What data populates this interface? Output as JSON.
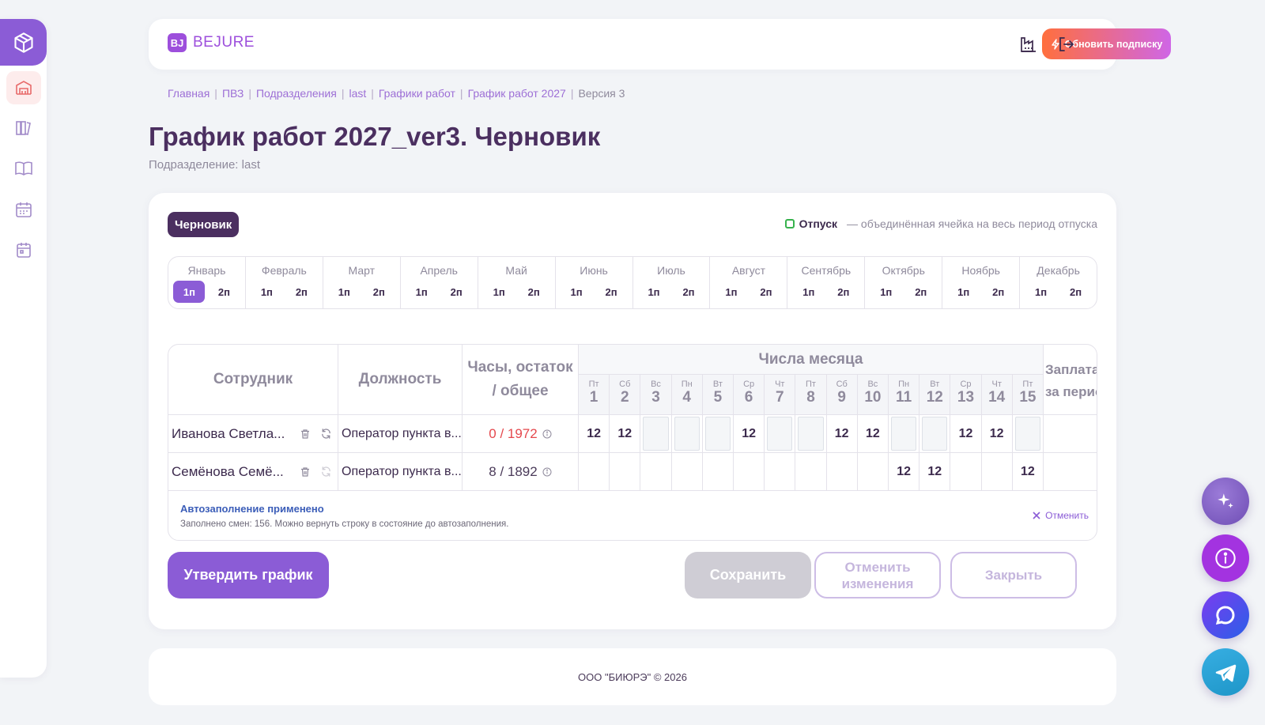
{
  "header": {
    "brand_mark": "BJ",
    "brand_name": "BEJURE",
    "upgrade_label": "Обновить подписку"
  },
  "breadcrumb": [
    "Главная",
    "ПВЗ",
    "Подразделения",
    "last",
    "Графики работ",
    "График работ 2027",
    "Версия 3"
  ],
  "page": {
    "title": "График работ 2027_ver3. Черновик",
    "subtitle": "Подразделение: last"
  },
  "card": {
    "status_badge": "Черновик",
    "legend_title": "Отпуск",
    "legend_text": "— объединённая ячейка на весь период отпуска"
  },
  "months": [
    {
      "name": "Январь",
      "p1": "1п",
      "p2": "2п"
    },
    {
      "name": "Февраль",
      "p1": "1п",
      "p2": "2п"
    },
    {
      "name": "Март",
      "p1": "1п",
      "p2": "2п"
    },
    {
      "name": "Апрель",
      "p1": "1п",
      "p2": "2п"
    },
    {
      "name": "Май",
      "p1": "1п",
      "p2": "2п"
    },
    {
      "name": "Июнь",
      "p1": "1п",
      "p2": "2п"
    },
    {
      "name": "Июль",
      "p1": "1п",
      "p2": "2п"
    },
    {
      "name": "Август",
      "p1": "1п",
      "p2": "2п"
    },
    {
      "name": "Сентябрь",
      "p1": "1п",
      "p2": "2п"
    },
    {
      "name": "Октябрь",
      "p1": "1п",
      "p2": "2п"
    },
    {
      "name": "Ноябрь",
      "p1": "1п",
      "p2": "2п"
    },
    {
      "name": "Декабрь",
      "p1": "1п",
      "p2": "2п"
    }
  ],
  "selected_period": {
    "month_index": 0,
    "period": "1п"
  },
  "table": {
    "col_employee": "Сотрудник",
    "col_position": "Должность",
    "col_hours_line1": "Часы, остаток",
    "col_hours_line2": "/ общее",
    "col_days": "Числа месяца",
    "col_payroll_line1": "Заплата",
    "col_payroll_line2": "за период",
    "days": [
      {
        "dow": "Пт",
        "num": "1"
      },
      {
        "dow": "Сб",
        "num": "2"
      },
      {
        "dow": "Вс",
        "num": "3"
      },
      {
        "dow": "Пн",
        "num": "4"
      },
      {
        "dow": "Вт",
        "num": "5"
      },
      {
        "dow": "Ср",
        "num": "6"
      },
      {
        "dow": "Чт",
        "num": "7"
      },
      {
        "dow": "Пт",
        "num": "8"
      },
      {
        "dow": "Сб",
        "num": "9"
      },
      {
        "dow": "Вс",
        "num": "10"
      },
      {
        "dow": "Пн",
        "num": "11"
      },
      {
        "dow": "Вт",
        "num": "12"
      },
      {
        "dow": "Ср",
        "num": "13"
      },
      {
        "dow": "Чт",
        "num": "14"
      },
      {
        "dow": "Пт",
        "num": "15"
      }
    ],
    "rows": [
      {
        "name": "Иванова Светла...",
        "position": "Оператор пункта в...",
        "hours": "0 / 1972",
        "hours_state": "alert",
        "shifts": [
          "12",
          "12",
          "",
          "",
          "",
          "12",
          "",
          "",
          "12",
          "12",
          "",
          "",
          "12",
          "12",
          ""
        ],
        "vacation_days": [
          3,
          4,
          5,
          7,
          8,
          11,
          12,
          15
        ]
      },
      {
        "name": "Семёнова Семё...",
        "position": "Оператор пункта в...",
        "hours": "8 / 1892",
        "hours_state": "ok",
        "shifts": [
          "",
          "",
          "",
          "",
          "",
          "",
          "",
          "",
          "",
          "",
          "12",
          "12",
          "",
          "",
          "12"
        ],
        "vacation_days": []
      }
    ]
  },
  "autofill": {
    "title": "Автозаполнение применено",
    "text": "Заполнено смен: 156. Можно вернуть строку в состояние до автозаполнения.",
    "cancel_label": "Отменить"
  },
  "actions": {
    "approve": "Утвердить график",
    "save": "Сохранить",
    "revert_line1": "Отменить",
    "revert_line2": "изменения",
    "close": "Закрыть"
  },
  "footer": {
    "text": "ООО \"БИЮРЭ\" © 2026"
  },
  "colors": {
    "accent": "#8b5cd6",
    "title": "#4b2f60",
    "alert": "#e5484d",
    "vacation": "#37b24d"
  }
}
